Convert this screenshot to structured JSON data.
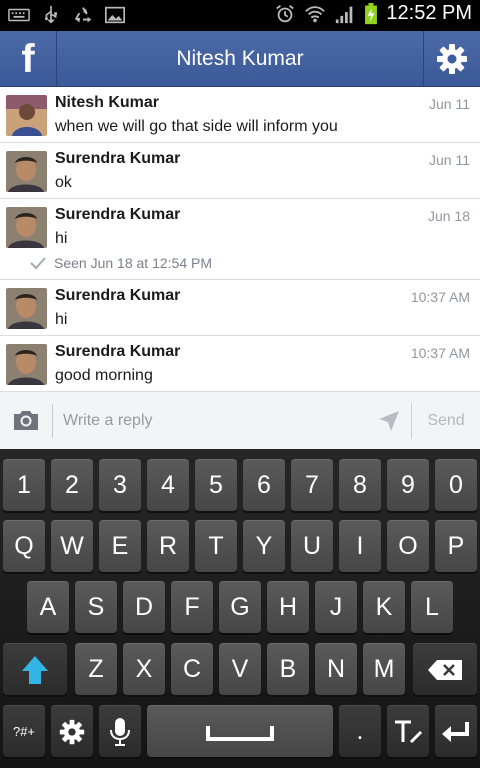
{
  "status_bar": {
    "time": "12:52 PM",
    "icons": [
      "keyboard-icon",
      "usb-icon",
      "recycle-icon",
      "picture-icon",
      "alarm-icon",
      "wifi-icon",
      "signal-icon",
      "battery-charging-icon"
    ]
  },
  "header": {
    "logo": "f",
    "title": "Nitesh Kumar"
  },
  "messages": [
    {
      "name": "Nitesh Kumar",
      "text": "when we will go that side will inform you",
      "time": "Jun 11",
      "avatar": "avatar-nitesh"
    },
    {
      "name": "Surendra Kumar",
      "text": "ok",
      "time": "Jun 11",
      "avatar": "avatar-surendra"
    },
    {
      "name": "Surendra Kumar",
      "text": "hi",
      "time": "Jun 18",
      "avatar": "avatar-surendra",
      "seen": "Seen Jun 18 at 12:54 PM"
    },
    {
      "name": "Surendra Kumar",
      "text": "hi",
      "time": "10:37 AM",
      "avatar": "avatar-surendra"
    },
    {
      "name": "Surendra Kumar",
      "text": "good morning",
      "time": "10:37 AM",
      "avatar": "avatar-surendra"
    }
  ],
  "reply": {
    "placeholder": "Write a reply",
    "send_label": "Send"
  },
  "keyboard": {
    "row1": [
      "1",
      "2",
      "3",
      "4",
      "5",
      "6",
      "7",
      "8",
      "9",
      "0"
    ],
    "row2": [
      "Q",
      "W",
      "E",
      "R",
      "T",
      "Y",
      "U",
      "I",
      "O",
      "P"
    ],
    "row3": [
      "A",
      "S",
      "D",
      "F",
      "G",
      "H",
      "J",
      "K",
      "L"
    ],
    "row4": [
      "Z",
      "X",
      "C",
      "V",
      "B",
      "N",
      "M"
    ],
    "symbols_label": "?#+",
    "period_label": ".",
    "shift_color": "#33b5e5"
  },
  "colors": {
    "header_blue": "#3b5998",
    "accent": "#33b5e5"
  }
}
